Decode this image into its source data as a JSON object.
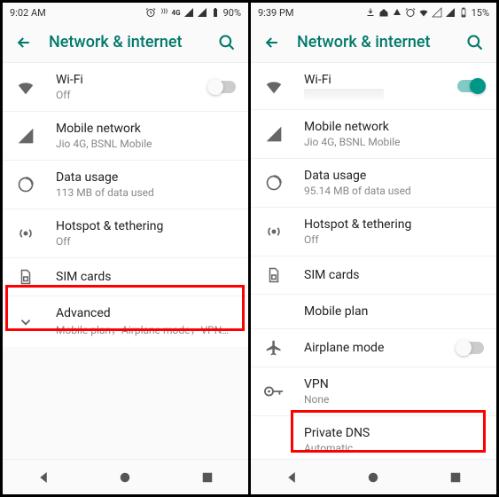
{
  "left": {
    "status": {
      "time": "9:02 AM",
      "battery": "90%",
      "network_badge": "4G"
    },
    "toolbar_title": "Network & internet",
    "wifi": {
      "label": "Wi-Fi",
      "sub": "Off",
      "on": false
    },
    "mobile": {
      "label": "Mobile network",
      "sub": "Jio 4G, BSNL Mobile"
    },
    "data": {
      "label": "Data usage",
      "sub": "113 MB of data used"
    },
    "hotspot": {
      "label": "Hotspot & tethering",
      "sub": "Off"
    },
    "sim": {
      "label": "SIM cards"
    },
    "advanced": {
      "label": "Advanced",
      "sub": "Mobile plan，Airplane mode，VPN，Priva…"
    }
  },
  "right": {
    "status": {
      "time": "9:39 PM",
      "battery": "15%"
    },
    "toolbar_title": "Network & internet",
    "wifi": {
      "label": "Wi-Fi",
      "on": true
    },
    "mobile": {
      "label": "Mobile network",
      "sub": "Jio 4G, BSNL Mobile"
    },
    "data": {
      "label": "Data usage",
      "sub": "95.14 MB of data used"
    },
    "hotspot": {
      "label": "Hotspot & tethering",
      "sub": "Off"
    },
    "sim": {
      "label": "SIM cards"
    },
    "mobileplan": {
      "label": "Mobile plan"
    },
    "airplane": {
      "label": "Airplane mode",
      "on": false
    },
    "vpn": {
      "label": "VPN",
      "sub": "None"
    },
    "privatedns": {
      "label": "Private DNS",
      "sub": "Automatic"
    }
  }
}
